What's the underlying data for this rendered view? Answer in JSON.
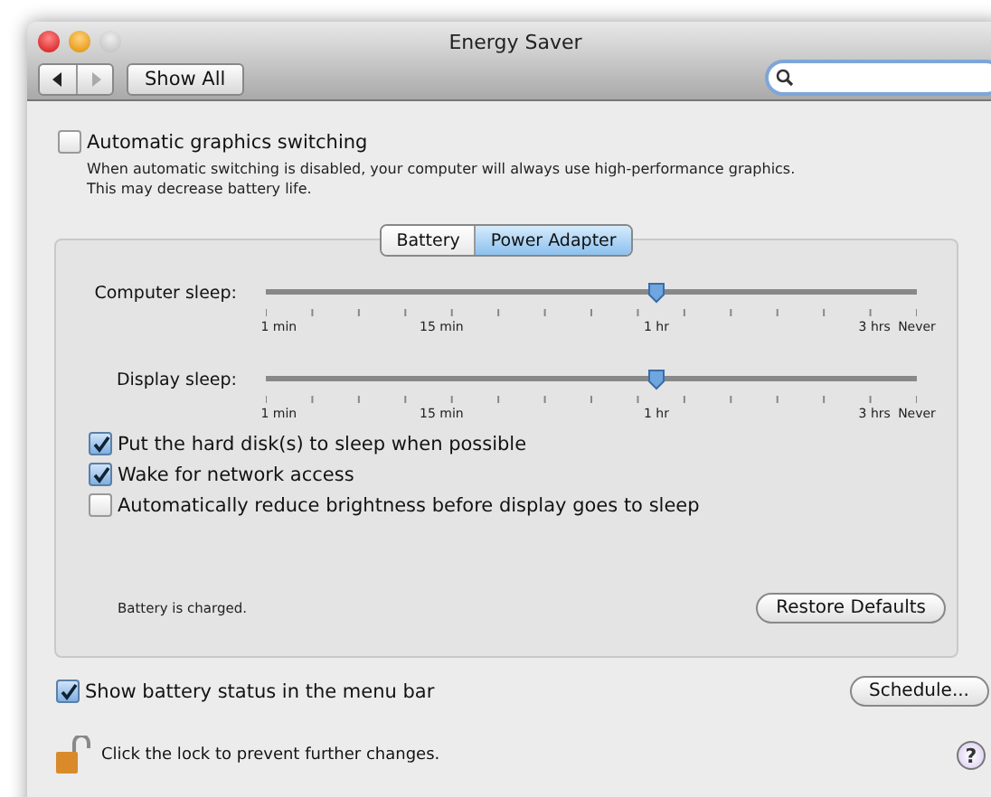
{
  "window": {
    "title": "Energy Saver"
  },
  "toolbar": {
    "show_all": "Show All",
    "back_disabled": false,
    "forward_disabled": true
  },
  "graphics_switching": {
    "label": "Automatic graphics switching",
    "checked": false,
    "description": "When automatic switching is disabled, your computer will always use high-performance graphics.\nThis may decrease battery life."
  },
  "tabs": [
    {
      "label": "Battery",
      "selected": false
    },
    {
      "label": "Power Adapter",
      "selected": true
    }
  ],
  "sliders": [
    {
      "label": "Computer sleep:",
      "level": 0.6,
      "ticks": [
        "1 min",
        "15 min",
        "1 hr",
        "3 hrs",
        "Never"
      ]
    },
    {
      "label": "Display sleep:",
      "level": 0.6,
      "ticks": [
        "1 min",
        "15 min",
        "1 hr",
        "3 hrs",
        "Never"
      ]
    }
  ],
  "options": [
    {
      "label": "Put the hard disk(s) to sleep when possible",
      "checked": true
    },
    {
      "label": "Wake for network access",
      "checked": true
    },
    {
      "label": "Automatically reduce brightness before display goes to sleep",
      "checked": false
    }
  ],
  "battery_status": "Battery is charged.",
  "restore_defaults": "Restore Defaults",
  "show_battery_status": {
    "label": "Show battery status in the menu bar",
    "checked": true
  },
  "schedule": "Schedule...",
  "lock": {
    "text": "Click the lock to prevent further changes."
  },
  "help": "?"
}
